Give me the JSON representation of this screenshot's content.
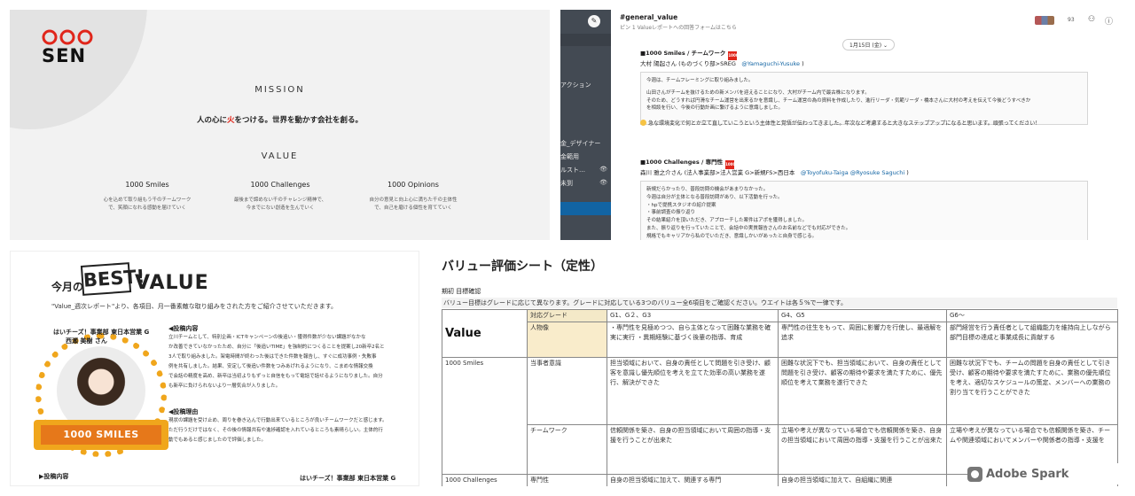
{
  "mission_panel": {
    "logo_text": "SEN",
    "mission_heading": "MISSION",
    "mission_text_pre": "人の心に",
    "mission_text_red": "火",
    "mission_text_post": "をつける。世界を動かす会社を創る。",
    "value_heading": "VALUE",
    "values": [
      {
        "title": "1000 Smiles",
        "desc1": "心を込めて取り組もう千のチームワーク",
        "desc2": "で、笑顔になれる感動を届けていく"
      },
      {
        "title": "1000 Challenges",
        "desc1": "最後まで諦めない千のチャレンジ精神で、",
        "desc2": "今までにない創造を生んでいく"
      },
      {
        "title": "1000 Opinions",
        "desc1": "自分の意見と向上心に満ちた千の主体性",
        "desc2": "で、自己を磨ける個性を育てていく"
      }
    ]
  },
  "slack_panel": {
    "channel": "#general_value",
    "subheader": "ピン 1  Valueレポートへの回答フォームはこちら",
    "member_count": "93",
    "date": "1月15日 (金)  ⌄",
    "sidebar_items": [
      "アクション",
      "金_デザイナー",
      "金範用",
      "ルスト…",
      "未到"
    ],
    "msg1": {
      "title": "■1000 Smiles / チームワーク",
      "author": "大村 陽起さん (ものづくり部>SREG",
      "mention": "@Yamaguchi-Yusuke",
      "author_end": ")",
      "body1": "今週は、チームフレーミングに取り組みました。",
      "body2": "山田さんがチームを抜けるための新メンバを迎えることになり、大村がチーム内で最古株になります。",
      "body3": "そのため、どうすれば円滑なチーム運営を出来るかを意識し、チーム運営の為の資料を作成したり、進行リーダ・気範リーダ・橋本さんに大村の考えを伝えて今後どうすべきか",
      "body4": "を相談を行い、今後の行動計画に繋げるように意識しました。",
      "reply": "急な環境変化で何とか立て直していこうという主体性と覚悟が伝わってきました。年次など考慮すると大きなステップアップになると思います。頑張ってください！"
    },
    "msg2": {
      "title": "■1000 Challenges / 専門性",
      "author": "森川 雅之介さん (法人事業部>法人営業 G>新規FS>西日本",
      "mention": "@Toyofuku-Taiga @Ryosuke Saguchi",
      "author_end": ")",
      "body1": "新規だらかったり、普段訪問の機会があまりなかった。",
      "body2": "今週は自分が主体となる普段訪問があり、以下活動を行った。",
      "body3": "・hpで提携スタジオの紹介提案",
      "body4": "・事前調査の振り返り",
      "body5": "その結果紹介を頂いただき、アプローチした案件はアポを獲得しました。",
      "body6": "また、振り返りを行っていたことで、会話中の実質報告さんのお名前などでも対応ができた。",
      "body7": "規格でもキャリアから私のでいただき、意識しかいがあったと自身で感じる。"
    }
  },
  "best_panel": {
    "tsuki": "今月の",
    "best": "BEST!",
    "value": "VALUE",
    "intro": "\"Value_週次レポート\"より、各項目、月一番素敵な取り組みをされた方をご紹介させていただきます。",
    "dept": "はいチーズ！事業部 東日本営業 G",
    "name": "西瀬 美樹 さん",
    "ribbon": "1000 SMILES",
    "section1_heading": "◀投稿内容",
    "section1_lines": [
      "立川チームとして、特別企画・ICTキャンペーンの後追い・獲得件数が少ない課題がなかな",
      "か改善できていなかったため、自分に「後追いTIME」を強制的につくることを提案し20新卒2名と",
      "3人で取り組みました。架電時間が終わった後はできた件数を報告し、すぐに成功事例・失敗事",
      "例を共有しました。結果、安定して後追い件数をつみあげれるようになり、こまめな情報交換",
      "で会話の精度を高め、新卒は当初よりもずっと自信をもって電話で話せるようになりました。自分",
      "も新卒に負けられないより一層気合が入りました。"
    ],
    "section2_heading": "◀投稿理由",
    "section2_lines": [
      "現状の課題を受け止め、周りを巻き込んで行動出来ているところが良いチームワークだと感じます。",
      "ただ行うだけではなく、その後の情報共有や進捗確認を入れているところも素晴らしい。主体的行",
      "動でもあると感じましたので評価しました。"
    ],
    "post_label": "▶投稿内容",
    "dept2": "はいチーズ！事業部 東日本営業 G"
  },
  "sheet_panel": {
    "title": "バリュー評価シート（定性）",
    "period": "期初 目標確認",
    "note": "バリュー目標はグレードに応じて異なります。グレードに対応している3つのバリュー全6項目をご確認ください。ウエイトは各５%で一律です。",
    "col_value": "Value",
    "col_grade": "対応グレード",
    "col_g1": "G1、G２、G3",
    "col_g4": "G4、G5",
    "col_g6": "G6～",
    "row_person": "人物像",
    "person_g1": "・専門性を見極めつつ、自ら主体となって困難な業務を確実に実行 ・異期経験に基づく後輩の指導、育成",
    "person_g4": "専門性の往生をもって、周囲に影響力を行使し、最適解を追求",
    "person_g6": "部門経営を行う責任者として組織能力を維持向上しながら部門目標の達成と事業成長に貢献する",
    "smiles_label": "1000 Smiles",
    "row_ownership": "当事者意識",
    "own_g1": "担当領域において、自身の責任として問題を引き受け、顧客を意識し優先順位を考えを立てた効率の高い業務を遂行、解決ができた",
    "own_g4": "困難な状況下でも、担当領域において、自身の責任として問題を引き受け、顧客の期待や要求を満たすために、優先順位を考えて業務を遂行できた",
    "own_g6": "困難な状況下でも、チームの問題を自身の責任として引き受け、顧客の期待や要求を満たすために、業務の優先順位を考え、適切なスケジュールの策定、メンバーへの業務の割り当てを行うことができた",
    "row_teamwork": "チームワーク",
    "team_g1": "信頼関係を築き、自身の担当領域において周囲の指導・支援を行うことが出来た",
    "team_g4": "立場や考えが異なっている場合でも信頼関係を築き、自身の担当領域において周囲の指導・支援を行うことが出来た",
    "team_g6": "立場や考えが異なっている場合でも信頼関係を築き、チームや関連領域においてメンバーや関係者の指導・支援を",
    "challenges_label": "1000 Challenges",
    "row_expertise": "専門性",
    "exp_g1": "自身の担当領域に加えて、関連する専門",
    "exp_g4": "自身の担当領域に加えて、自組織に関連",
    "exp_g6": "",
    "watermark": "Adobe Spark"
  }
}
